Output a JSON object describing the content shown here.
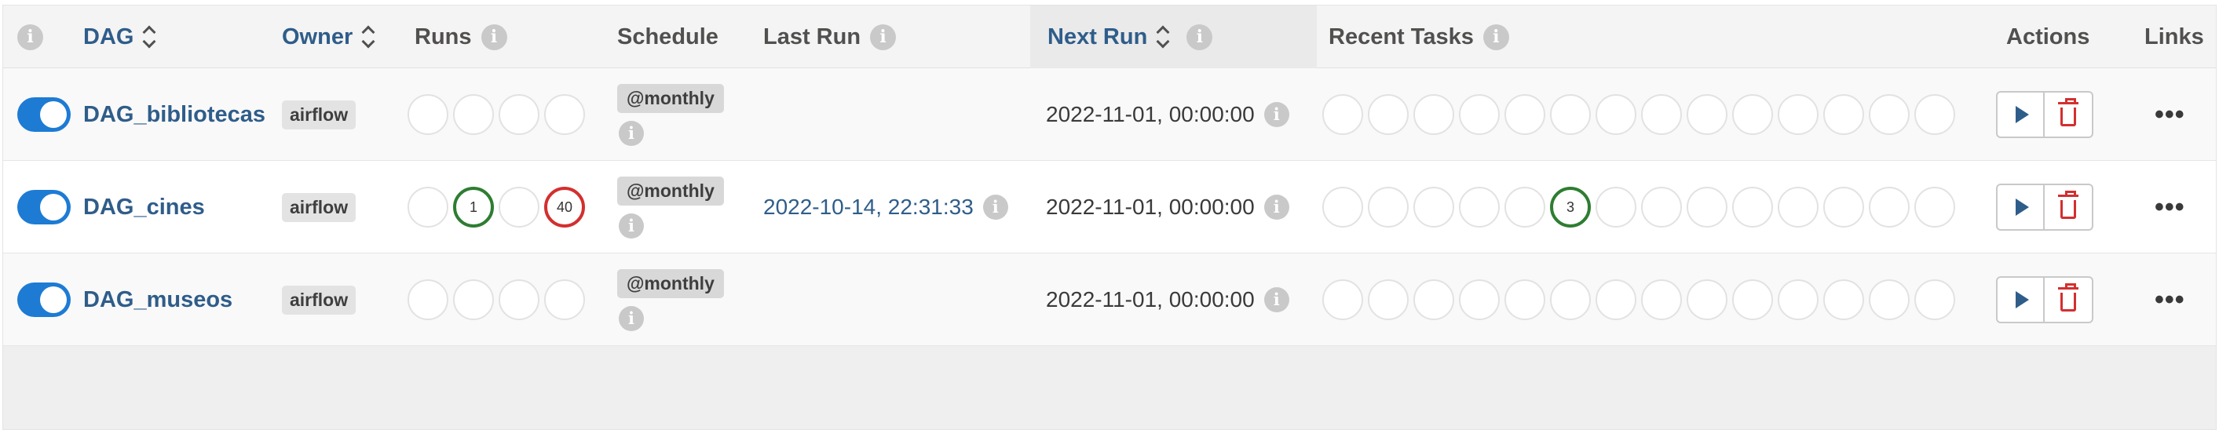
{
  "headers": {
    "dag": "DAG",
    "owner": "Owner",
    "runs": "Runs",
    "schedule": "Schedule",
    "last_run": "Last Run",
    "next_run": "Next Run",
    "recent_tasks": "Recent Tasks",
    "actions": "Actions",
    "links": "Links"
  },
  "icons": {
    "info": "i",
    "links_menu": "•••"
  },
  "rows": [
    {
      "dag_id": "DAG_bibliotecas",
      "owner": "airflow",
      "paused": false,
      "runs": [
        "",
        "",
        "",
        ""
      ],
      "schedule": "@monthly",
      "last_run": "",
      "next_run": "2022-11-01, 00:00:00",
      "recent_tasks": [
        "",
        "",
        "",
        "",
        "",
        "",
        "",
        "",
        "",
        "",
        "",
        "",
        "",
        ""
      ]
    },
    {
      "dag_id": "DAG_cines",
      "owner": "airflow",
      "paused": false,
      "runs": [
        "",
        "1",
        "",
        "40"
      ],
      "schedule": "@monthly",
      "last_run": "2022-10-14, 22:31:33",
      "next_run": "2022-11-01, 00:00:00",
      "recent_tasks": [
        "",
        "",
        "",
        "",
        "",
        "3",
        "",
        "",
        "",
        "",
        "",
        "",
        "",
        ""
      ]
    },
    {
      "dag_id": "DAG_museos",
      "owner": "airflow",
      "paused": false,
      "runs": [
        "",
        "",
        "",
        ""
      ],
      "schedule": "@monthly",
      "last_run": "",
      "next_run": "2022-11-01, 00:00:00",
      "recent_tasks": [
        "",
        "",
        "",
        "",
        "",
        "",
        "",
        "",
        "",
        "",
        "",
        "",
        "",
        ""
      ]
    }
  ],
  "colors": {
    "success": "#2e7d32",
    "failed": "#d32f2f",
    "toggle_on": "#1d7bd4",
    "link": "#2f5d8a"
  }
}
